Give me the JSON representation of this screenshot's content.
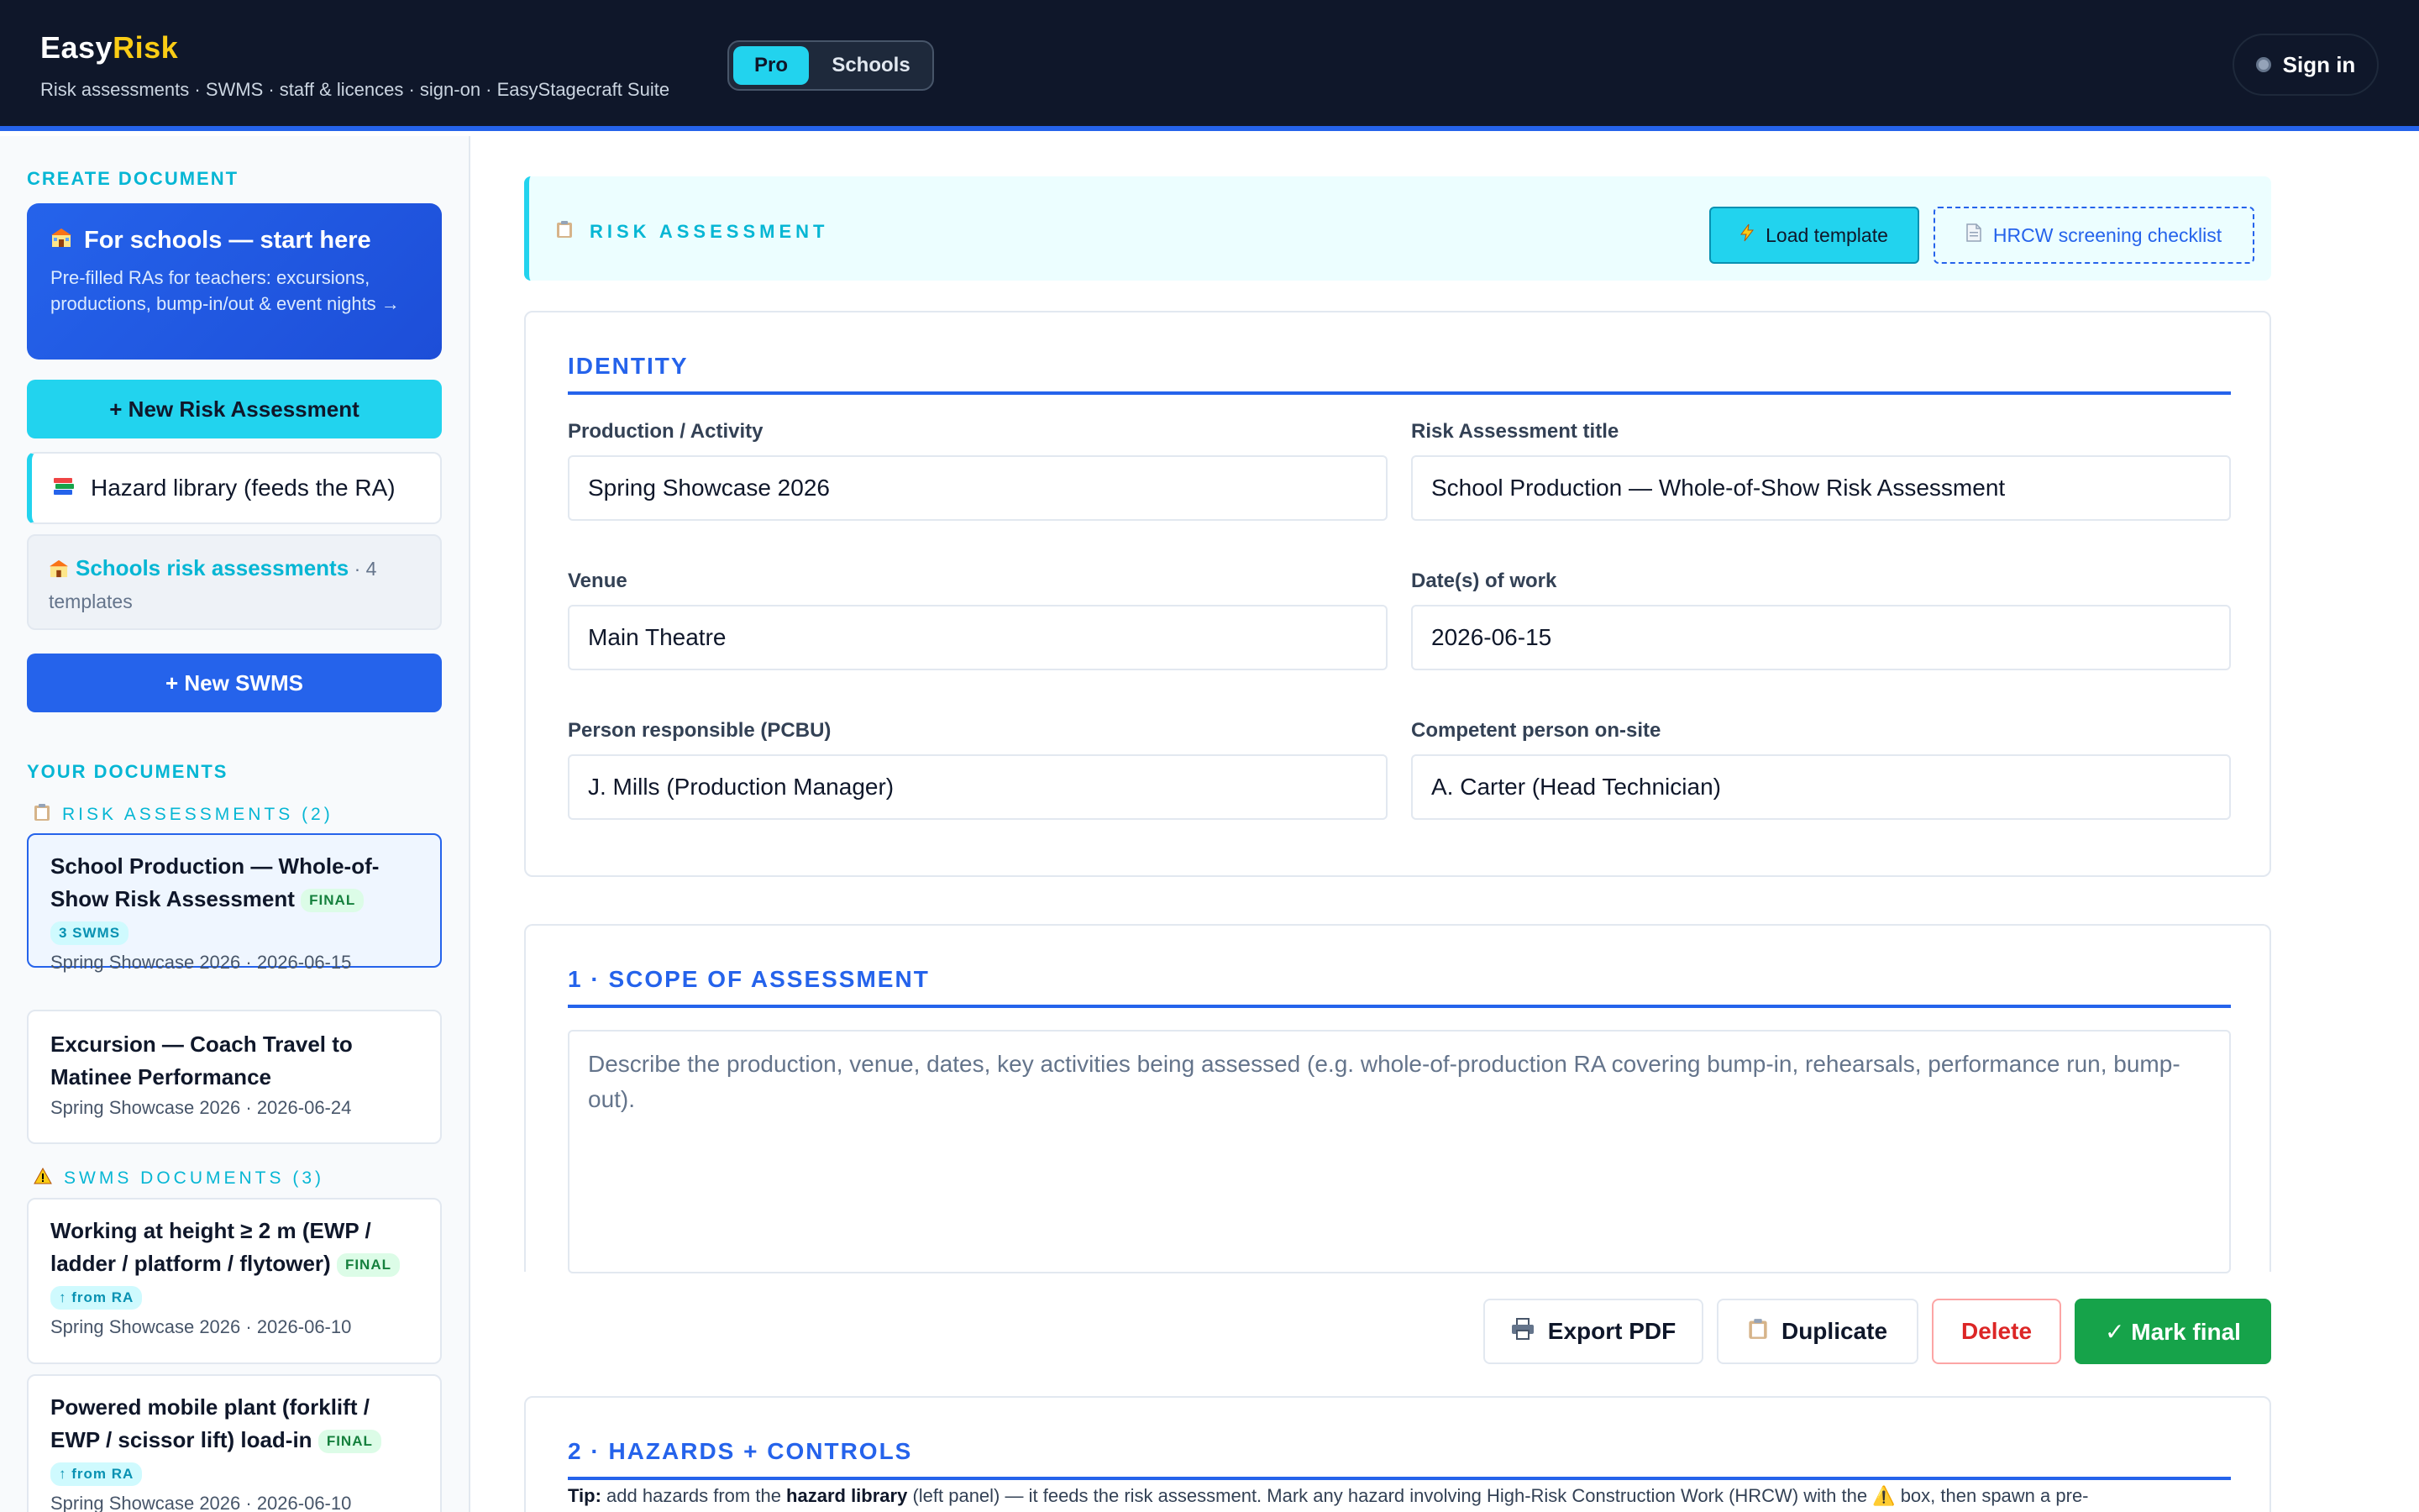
{
  "header": {
    "brand_main": "Easy",
    "brand_accent": "Risk",
    "tagline": "Risk assessments · SWMS · staff & licences · sign-on · EasyStagecraft Suite",
    "mode_pro": "Pro",
    "mode_schools": "Schools",
    "signin": "Sign in"
  },
  "sidebar": {
    "create_title": "CREATE DOCUMENT",
    "schools_card_title": "For schools — start here",
    "schools_card_desc": "Pre-filled RAs for teachers: excursions, productions, bump-in/out & event nights →",
    "new_ra": "+ New Risk Assessment",
    "hazard_library": "Hazard library (feeds the RA)",
    "schools_ra_link": "Schools risk assessments",
    "schools_ra_count": " · 4 templates",
    "new_swms": "+ New SWMS",
    "your_docs_title": "YOUR DOCUMENTS",
    "ra_group": "RISK ASSESSMENTS (2)",
    "swms_group": "SWMS DOCUMENTS (3)",
    "ra_docs": [
      {
        "title": "School Production — Whole-of-Show Risk Assessment",
        "badge": "FINAL",
        "badge2": "3 SWMS",
        "meta": "Spring Showcase 2026 · 2026-06-15"
      },
      {
        "title": "Excursion — Coach Travel to Matinee Performance",
        "meta": "Spring Showcase 2026 · 2026-06-24"
      }
    ],
    "swms_docs": [
      {
        "title": "Working at height ≥ 2 m (EWP / ladder / platform / flytower)",
        "badge": "FINAL",
        "badge2": "↑ from RA",
        "meta": "Spring Showcase 2026 · 2026-06-10"
      },
      {
        "title": "Powered mobile plant (forklift / EWP / scissor lift) load-in",
        "badge": "FINAL",
        "badge2": "↑ from RA",
        "meta": "Spring Showcase 2026 · 2026-06-10"
      }
    ]
  },
  "main": {
    "banner_label": "RISK ASSESSMENT",
    "load_template": "Load template",
    "hrcw_checklist": "HRCW screening checklist",
    "identity_title": "IDENTITY",
    "fields": {
      "production_label": "Production / Activity",
      "production_value": "Spring Showcase 2026",
      "title_label": "Risk Assessment title",
      "title_value": "School Production — Whole-of-Show Risk Assessment",
      "venue_label": "Venue",
      "venue_value": "Main Theatre",
      "dates_label": "Date(s) of work",
      "dates_value": "2026-06-15",
      "pcbu_label": "Person responsible (PCBU)",
      "pcbu_value": "J. Mills (Production Manager)",
      "competent_label": "Competent person on-site",
      "competent_value": "A. Carter (Head Technician)"
    },
    "scope_title": "1 · SCOPE OF ASSESSMENT",
    "scope_placeholder": "Describe the production, venue, dates, key activities being assessed (e.g. whole-of-production RA covering bump-in, rehearsals, performance run, bump-out).",
    "actions": {
      "export": "Export PDF",
      "duplicate": "Duplicate",
      "delete": "Delete",
      "final": "✓ Mark final"
    },
    "hazards_title": "2 · HAZARDS + CONTROLS",
    "tip_lead": "Tip:",
    "tip_1": " add hazards from the ",
    "tip_bold": "hazard library",
    "tip_2": " (left panel) — it feeds the risk assessment. Mark any hazard involving High-Risk Construction Work (HRCW) with the ⚠️ box, then spawn a pre-"
  },
  "icons": {
    "school": "school-icon",
    "books": "books-icon",
    "clipboard": "clipboard-icon",
    "warning": "warning-icon",
    "bolt": "bolt-icon",
    "document": "document-icon",
    "printer": "printer-icon"
  },
  "colors": {
    "header_bg": "#0f172a",
    "accent_cyan": "#22d3ee",
    "accent_blue": "#2563eb",
    "brand_yellow": "#facc15",
    "final_green": "#16a34a",
    "delete_red": "#dc2626"
  }
}
